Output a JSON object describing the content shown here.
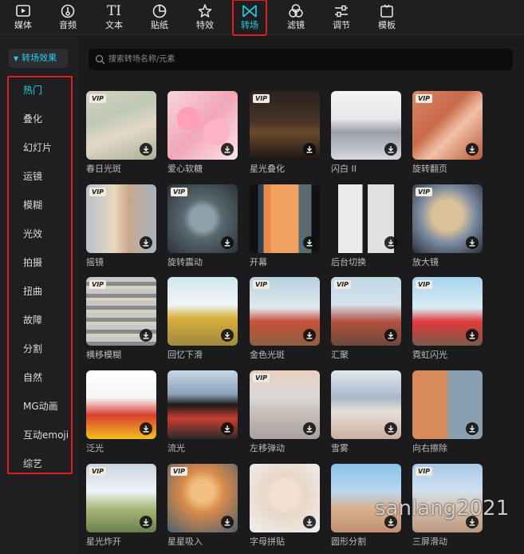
{
  "toolbar": {
    "items": [
      {
        "label": "媒体",
        "icon": "media-icon"
      },
      {
        "label": "音频",
        "icon": "audio-icon"
      },
      {
        "label": "文本",
        "icon": "text-icon"
      },
      {
        "label": "贴纸",
        "icon": "sticker-icon"
      },
      {
        "label": "特效",
        "icon": "effects-icon"
      },
      {
        "label": "转场",
        "icon": "transition-icon",
        "active": true
      },
      {
        "label": "滤镜",
        "icon": "filter-icon"
      },
      {
        "label": "调节",
        "icon": "adjust-icon"
      },
      {
        "label": "模板",
        "icon": "template-icon"
      }
    ],
    "text_icon_glyph": "TI"
  },
  "sidebar": {
    "header": "转场效果",
    "categories": [
      "热门",
      "叠化",
      "幻灯片",
      "运镜",
      "模糊",
      "光效",
      "拍摄",
      "扭曲",
      "故障",
      "分割",
      "自然",
      "MG动画",
      "互动emoji",
      "综艺"
    ],
    "active_index": 0
  },
  "search": {
    "placeholder": "搜索转场名称/元素",
    "value": ""
  },
  "vip_label": "VIP",
  "transitions": [
    {
      "name": "春日光斑",
      "vip": true
    },
    {
      "name": "爱心软糖",
      "vip": false
    },
    {
      "name": "星光叠化",
      "vip": true
    },
    {
      "name": "闪白 II",
      "vip": false
    },
    {
      "name": "旋转翻页",
      "vip": true
    },
    {
      "name": "摇镜",
      "vip": true
    },
    {
      "name": "旋转震动",
      "vip": true
    },
    {
      "name": "开幕",
      "vip": false
    },
    {
      "name": "后台切换",
      "vip": false
    },
    {
      "name": "放大镜",
      "vip": true
    },
    {
      "name": "横移模糊",
      "vip": true
    },
    {
      "name": "回忆下滑",
      "vip": false
    },
    {
      "name": "金色光斑",
      "vip": true
    },
    {
      "name": "汇聚",
      "vip": true
    },
    {
      "name": "霓虹闪光",
      "vip": true
    },
    {
      "name": "泛光",
      "vip": false
    },
    {
      "name": "流光",
      "vip": false
    },
    {
      "name": "左移弹动",
      "vip": true
    },
    {
      "name": "雪雾",
      "vip": false
    },
    {
      "name": "向右擦除",
      "vip": false
    },
    {
      "name": "星光炸开",
      "vip": true
    },
    {
      "name": "星星吸入",
      "vip": true
    },
    {
      "name": "字母拼贴",
      "vip": false
    },
    {
      "name": "圆形分割",
      "vip": false
    },
    {
      "name": "三屏滑动",
      "vip": true
    }
  ],
  "watermark": "sanlang2021",
  "colors": {
    "accent": "#22d3e6",
    "highlight_border": "#e02020",
    "background": "#1b1b1e"
  }
}
